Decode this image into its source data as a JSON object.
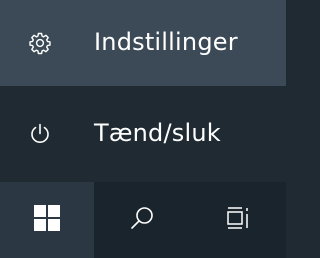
{
  "start_menu": {
    "items": [
      {
        "label": "Indstillinger",
        "icon": "gear-icon"
      },
      {
        "label": "Tænd/sluk",
        "icon": "power-icon"
      }
    ]
  },
  "taskbar": {
    "buttons": [
      {
        "icon": "windows-logo-icon"
      },
      {
        "icon": "search-icon"
      },
      {
        "icon": "task-view-icon"
      }
    ]
  },
  "colors": {
    "settings_bg": "#3b4a56",
    "menu_bg": "#1f2a33",
    "taskbar_bg": "#1a242d",
    "start_button_bg": "#2b3844",
    "foreground": "#ffffff"
  }
}
